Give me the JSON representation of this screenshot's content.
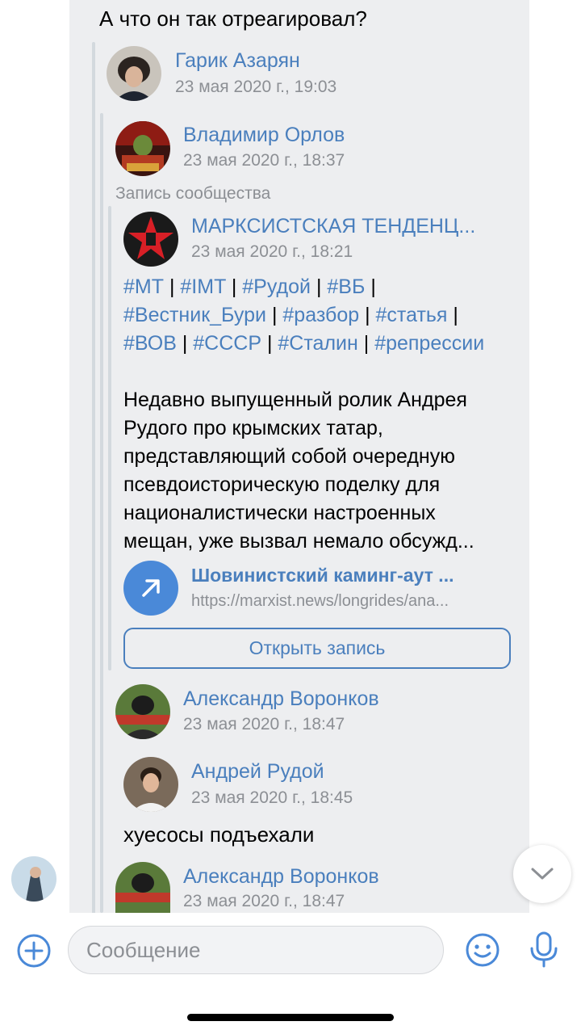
{
  "message": {
    "text": "А что он так отреагировал?"
  },
  "reply1": {
    "name": "Гарик Азарян",
    "date": "23 мая 2020 г., 19:03"
  },
  "reply2": {
    "name": "Владимир Орлов",
    "date": "23 мая 2020 г., 18:37"
  },
  "community_label": "Запись сообщества",
  "community": {
    "name": "МАРКСИСТСКАЯ ТЕНДЕНЦ...",
    "date": "23 мая 2020 г., 18:21"
  },
  "tags": {
    "line1": [
      "#МТ",
      "#IMT",
      "#Рудой",
      "#ВБ"
    ],
    "line2": [
      "#Вестник_Бури",
      "#разбор",
      "#статья"
    ],
    "line3": [
      "#ВОВ",
      "#СССР",
      "#Сталин",
      "#репрессии"
    ]
  },
  "post_text": [
    "Недавно выпущенный ролик Андрея",
    "Рудого про крымских татар,",
    "представляющий собой очередную",
    "псевдоисторическую поделку для",
    "националистически настроенных",
    "мещан, уже вызвал немало обсужд..."
  ],
  "link": {
    "title": "Шовинистский каминг-аут ...",
    "url": "https://marxist.news/longrides/ana..."
  },
  "open_button": "Открыть запись",
  "reply3": {
    "name": "Александр Воронков",
    "date": "23 мая 2020 г., 18:47"
  },
  "reply4": {
    "name": "Андрей Рудой",
    "date": "23 мая 2020 г., 18:45",
    "text": "хуесосы подъехали"
  },
  "reply5": {
    "name": "Александр Воронков",
    "date": "23 мая 2020 г., 18:47"
  },
  "composer": {
    "placeholder": "Сообщение"
  },
  "colors": {
    "accent": "#4a7fbd",
    "bubble": "#edeef0",
    "secondary_text": "#8c8f94"
  },
  "icons": [
    "add-icon",
    "emoji-icon",
    "microphone-icon",
    "chevron-down-icon",
    "arrow-up-right-icon"
  ]
}
